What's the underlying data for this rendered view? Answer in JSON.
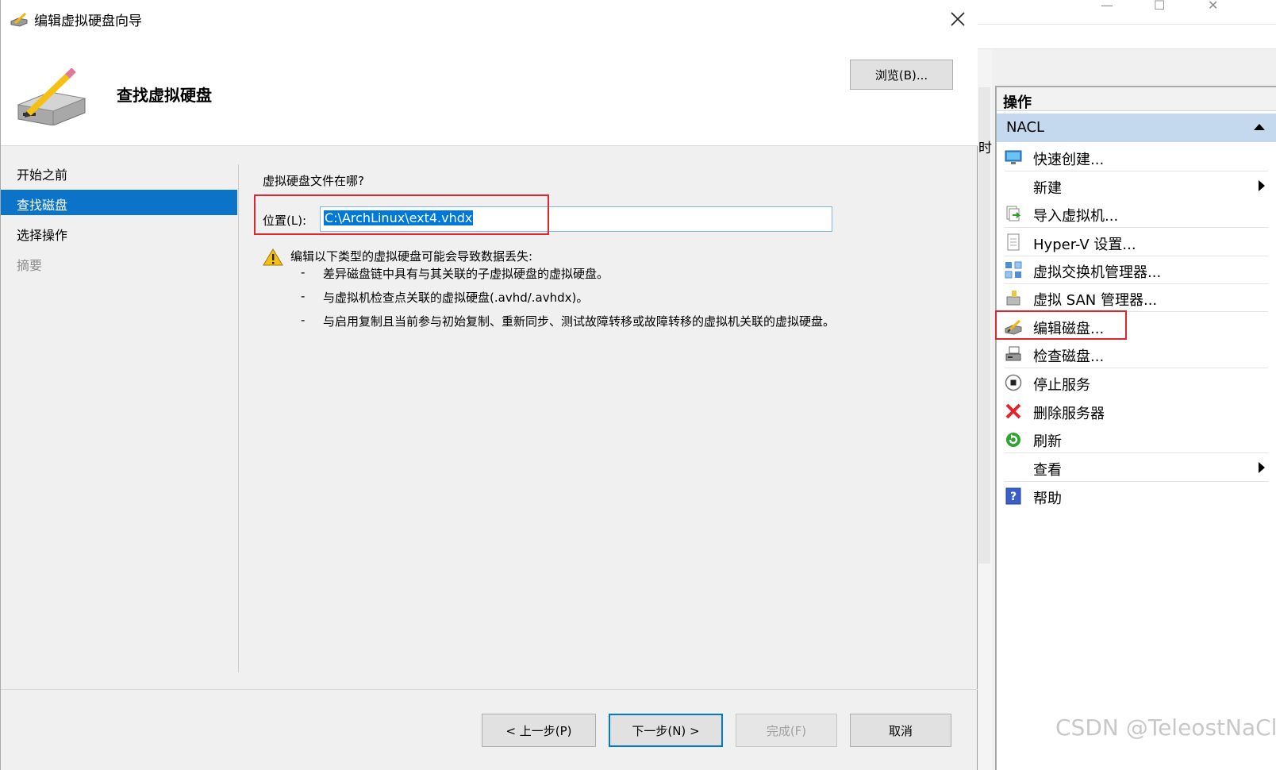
{
  "dialog": {
    "title": "编辑虚拟硬盘向导",
    "header_title": "查找虚拟硬盘",
    "nav": [
      {
        "label": "开始之前",
        "state": "normal"
      },
      {
        "label": "查找磁盘",
        "state": "selected"
      },
      {
        "label": "选择操作",
        "state": "normal"
      },
      {
        "label": "摘要",
        "state": "disabled"
      }
    ],
    "question": "虚拟硬盘文件在哪?",
    "location_label": "位置(L):",
    "location_value": "C:\\ArchLinux\\ext4.vhdx",
    "browse_label": "浏览(B)...",
    "warning": "编辑以下类型的虚拟硬盘可能会导致数据丢失:",
    "bullets": [
      "差异磁盘链中具有与其关联的子虚拟硬盘的虚拟硬盘。",
      "与虚拟机检查点关联的虚拟硬盘(.avhd/.avhdx)。",
      "与启用复制且当前参与初始复制、重新同步、测试故障转移或故障转移的虚拟机关联的虚拟硬盘。"
    ],
    "bullet_mark": "-",
    "buttons": {
      "prev": "< 上一步(P)",
      "next": "下一步(N) >",
      "finish": "完成(F)",
      "cancel": "取消"
    }
  },
  "actions_panel": {
    "header": "操作",
    "group": "NACL",
    "items": [
      {
        "label": "快速创建...",
        "icon": "monitor-icon"
      },
      {
        "label": "新建",
        "icon": "none",
        "submenu": true
      },
      {
        "label": "导入虚拟机...",
        "icon": "import-icon"
      },
      {
        "label": "Hyper-V 设置...",
        "icon": "settings-doc-icon"
      },
      {
        "label": "虚拟交换机管理器...",
        "icon": "switch-icon"
      },
      {
        "label": "虚拟 SAN 管理器...",
        "icon": "san-icon"
      },
      {
        "label": "编辑磁盘...",
        "icon": "edit-disk-icon"
      },
      {
        "label": "检查磁盘...",
        "icon": "inspect-disk-icon"
      },
      {
        "label": "停止服务",
        "icon": "stop-icon"
      },
      {
        "label": "删除服务器",
        "icon": "delete-x-icon"
      },
      {
        "label": "刷新",
        "icon": "refresh-icon"
      },
      {
        "label": "查看",
        "icon": "none",
        "submenu": true
      },
      {
        "label": "帮助",
        "icon": "help-icon"
      }
    ]
  },
  "partial_text": "时",
  "watermark": "CSDN @TeleostNaCl",
  "colors": {
    "selection_blue": "#0b74c8",
    "group_bar": "#c4d9ee",
    "highlight_red": "#e0262c"
  }
}
